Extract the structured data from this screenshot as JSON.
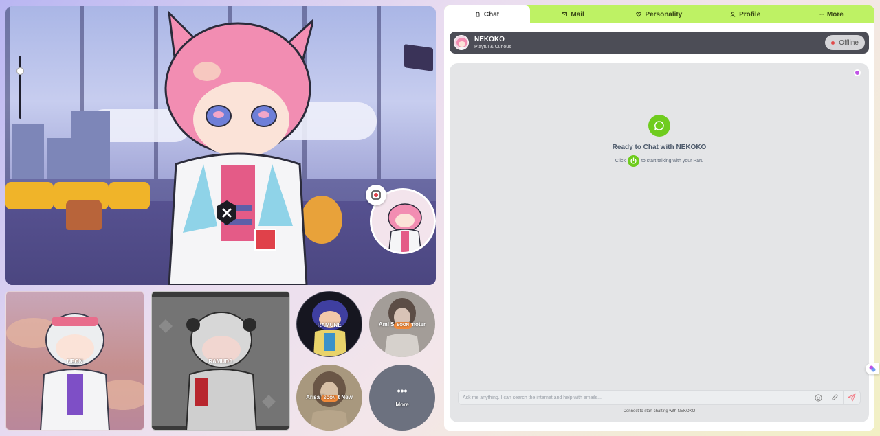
{
  "scene": {
    "close_icon": "close-x-icon",
    "mini_badge_icon": "camera-location-icon"
  },
  "characters": {
    "neon": {
      "name": "NEON"
    },
    "ramuda": {
      "name": "RAMUDA"
    },
    "ramune": {
      "name": "RAMUNE"
    },
    "ami": {
      "name_left": "Ami Spo",
      "name_right": "romoter",
      "badge": "SOON"
    },
    "arisa": {
      "name_left": "Arisa To",
      "name_right": "ent New",
      "badge": "SOON"
    },
    "more": {
      "label": "More",
      "icon": "ellipsis-icon"
    }
  },
  "tabs": [
    {
      "label": "Chat",
      "icon": "hand-icon",
      "active": true
    },
    {
      "label": "Mail",
      "icon": "mail-icon"
    },
    {
      "label": "Personality",
      "icon": "heart-icon"
    },
    {
      "label": "Profile",
      "icon": "user-icon"
    },
    {
      "label": "More",
      "icon": "ellipsis-icon"
    }
  ],
  "header": {
    "name": "NEKOKO",
    "subtitle": "Playful & Curious",
    "status": "Offline",
    "status_color": "#e14a4a"
  },
  "chat": {
    "empty_title": "Ready to Chat with NEKOKO",
    "hint_before": "Click",
    "hint_after": "to start talking with your Paru",
    "input_placeholder": "Ask me anything. I can search the internet and help with emails...",
    "footer": "Connect to start chatting with NEKOKO"
  },
  "colors": {
    "accent_green": "#bef264",
    "icon_green": "#6fcc1e",
    "header_dark": "#4c4d56"
  }
}
